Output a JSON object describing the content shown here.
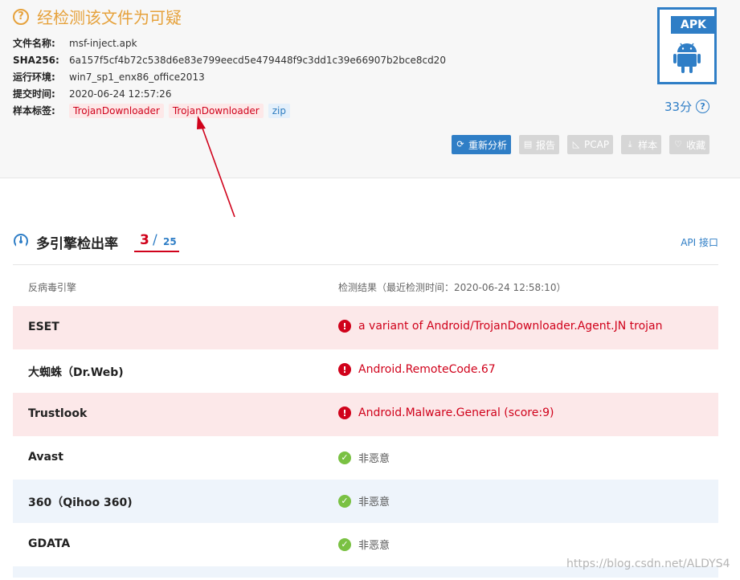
{
  "summary": {
    "verdict_title": "经检测该文件为可疑",
    "fields": [
      {
        "key": "文件名称:",
        "value": "msf-inject.apk"
      },
      {
        "key": "SHA256:",
        "value": "6a157f5cf4b72c538d6e83e799eecd5e479448f9c3dd1c39e66907b2bce8cd20"
      },
      {
        "key": "运行环境:",
        "value": "win7_sp1_enx86_office2013"
      },
      {
        "key": "提交时间:",
        "value": "2020-06-24 12:57:26"
      }
    ],
    "tags_key": "样本标签:",
    "tags": [
      "TrojanDownloader",
      "TrojanDownloader",
      "zip"
    ],
    "file_type_badge": "APK",
    "score": "33分",
    "actions": [
      "重新分析",
      "报告",
      "PCAP",
      "样本",
      "收藏"
    ]
  },
  "engines": {
    "title": "多引擎检出率",
    "detected": "3",
    "separator": "/",
    "total": "25",
    "api_link": "API 接口",
    "col_engine": "反病毒引擎",
    "col_result": "检测结果（最近检测时间：2020-06-24 12:58:10）",
    "rows": [
      {
        "engine": "ESET",
        "result": "a variant of Android/TrojanDownloader.Agent.JN trojan",
        "status": "malicious"
      },
      {
        "engine": "大蜘蛛（Dr.Web)",
        "result": "Android.RemoteCode.67",
        "status": "malicious"
      },
      {
        "engine": "Trustlook",
        "result": "Android.Malware.General (score:9)",
        "status": "malicious"
      },
      {
        "engine": "Avast",
        "result": "非恶意",
        "status": "clean"
      },
      {
        "engine": "360（Qihoo 360)",
        "result": "非恶意",
        "status": "clean"
      },
      {
        "engine": "GDATA",
        "result": "非恶意",
        "status": "clean"
      }
    ]
  },
  "watermark": "https://blog.csdn.net/ALDYS4",
  "colors": {
    "warning": "#e6a23c",
    "danger": "#d0021b",
    "brand": "#2f7ec6",
    "ok": "#7ac143"
  }
}
